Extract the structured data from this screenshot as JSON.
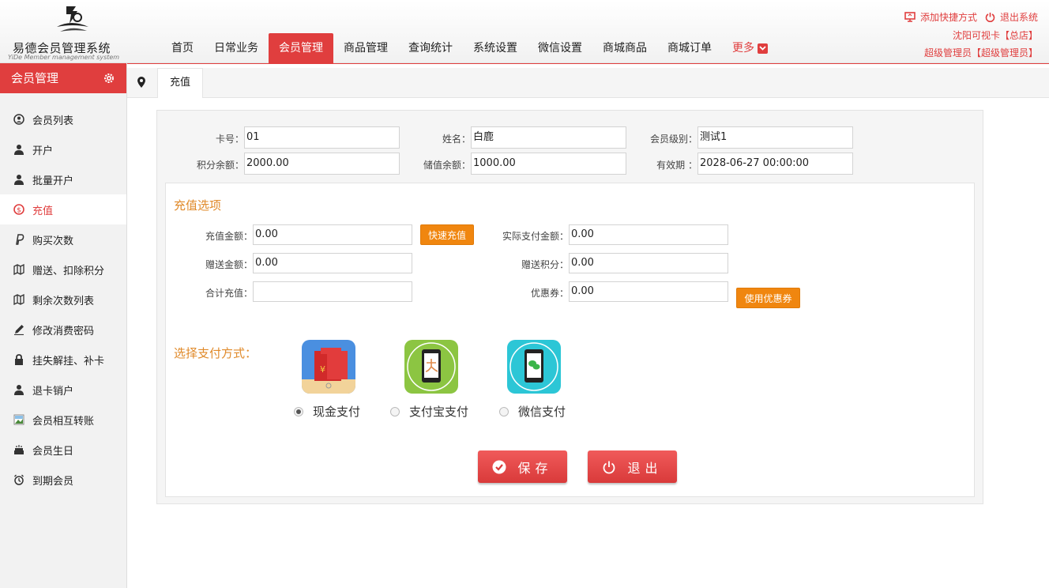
{
  "header": {
    "logo_title": "易德会员管理系统",
    "logo_subtitle": "YiDe Member management system",
    "nav": [
      "首页",
      "日常业务",
      "会员管理",
      "商品管理",
      "查询统计",
      "系统设置",
      "微信设置",
      "商城商品",
      "商城订单",
      "更多"
    ],
    "active_nav": "会员管理",
    "add_shortcut": "添加快捷方式",
    "logout": "退出系统",
    "store": "沈阳可视卡【总店】",
    "user": "超级管理员【超级管理员】"
  },
  "sidebar": {
    "title": "会员管理",
    "items": [
      {
        "label": "会员列表",
        "icon": "user-circle-icon"
      },
      {
        "label": "开户",
        "icon": "user-icon"
      },
      {
        "label": "批量开户",
        "icon": "user-icon"
      },
      {
        "label": "充值",
        "icon": "coin-icon"
      },
      {
        "label": "购买次数",
        "icon": "paypal-icon"
      },
      {
        "label": "赠送、扣除积分",
        "icon": "map-icon"
      },
      {
        "label": "剩余次数列表",
        "icon": "map-icon"
      },
      {
        "label": "修改消费密码",
        "icon": "pencil-icon"
      },
      {
        "label": "挂失解挂、补卡",
        "icon": "lock-icon"
      },
      {
        "label": "退卡销户",
        "icon": "user-icon"
      },
      {
        "label": "会员相互转账",
        "icon": "image-icon"
      },
      {
        "label": "会员生日",
        "icon": "cake-icon"
      },
      {
        "label": "到期会员",
        "icon": "alarm-icon"
      }
    ],
    "active": "充值"
  },
  "tabs": {
    "current": "充值"
  },
  "member": {
    "card_label": "卡号：",
    "card_value": "01",
    "name_label": "姓名：",
    "name_value": "白鹿",
    "level_label": "会员级别：",
    "level_value": "测试1",
    "points_label": "积分余额：",
    "points_value": "2000.00",
    "balance_label": "储值余额：",
    "balance_value": "1000.00",
    "expiry_label": "有效期 ：",
    "expiry_value": "2028-06-27 00:00:00"
  },
  "recharge": {
    "section_title": "充值选项",
    "amount_label": "充值金额：",
    "amount_value": "0.00",
    "quick_btn": "快速充值",
    "actual_label": "实际支付金额：",
    "actual_value": "0.00",
    "gift_label": "赠送金额：",
    "gift_value": "0.00",
    "gift_points_label": "赠送积分：",
    "gift_points_value": "0.00",
    "total_label": "合计充值：",
    "total_value": "",
    "coupon_label": "优惠券：",
    "coupon_value": "0.00",
    "coupon_btn": "使用优惠券"
  },
  "payment": {
    "title": "选择支付方式：",
    "options": [
      "现金支付",
      "支付宝支付",
      "微信支付"
    ],
    "selected": "现金支付"
  },
  "actions": {
    "save": "保存",
    "exit": "退出"
  },
  "colors": {
    "accent": "#e03e3e",
    "orange": "#f0860f",
    "section": "#e08a2a"
  }
}
